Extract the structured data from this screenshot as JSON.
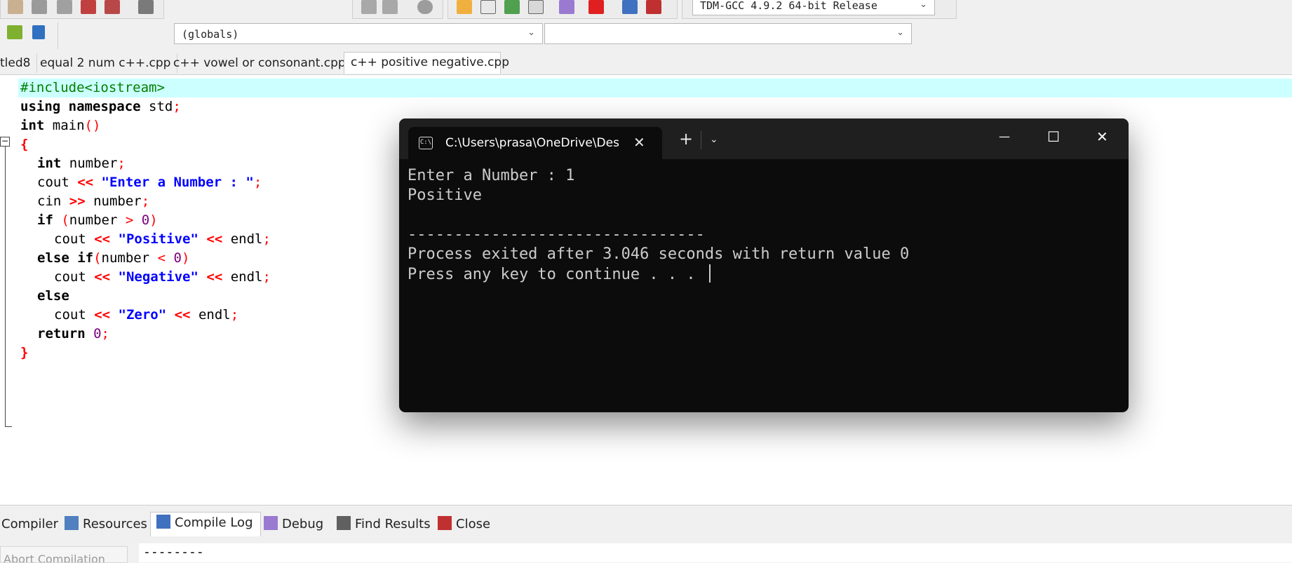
{
  "toolbar": {
    "compiler_select": "TDM-GCC 4.9.2 64-bit Release",
    "scope_select": "(globals)",
    "symbol_select": ""
  },
  "tabs": [
    {
      "label": "tled8",
      "active": false
    },
    {
      "label": "equal 2 num c++.cpp",
      "active": false
    },
    {
      "label": "c++ vowel or consonant.cpp",
      "active": false
    },
    {
      "label": "c++ positive  negative.cpp",
      "active": true
    }
  ],
  "editor": {
    "code": {
      "l1": "#include<iostream>",
      "l2_kw": "using namespace",
      "l2_rest": " std",
      "l2_semi": ";",
      "l3_kw": "int",
      "l3_fn": " main",
      "l3_parens": "()",
      "l4": "{",
      "l5_kw": "int",
      "l5_id": " number",
      "l5_semi": ";",
      "l6_id": "cout ",
      "l6_op": "<<",
      "l6_str": " \"Enter a Number : \"",
      "l6_semi": ";",
      "l7_id": "cin ",
      "l7_op": ">>",
      "l7_id2": " number",
      "l7_semi": ";",
      "l8_kw": "if",
      "l8_open": " (",
      "l8_id": "number ",
      "l8_op": ">",
      "l8_num": " 0",
      "l8_close": ")",
      "l9_id": "cout ",
      "l9_op": "<<",
      "l9_str": " \"Positive\"",
      "l9_op2": " <<",
      "l9_endl": " endl",
      "l9_semi": ";",
      "l10_kw": "else if",
      "l10_open": "(",
      "l10_id": "number ",
      "l10_op": "<",
      "l10_num": " 0",
      "l10_close": ")",
      "l11_id": "cout ",
      "l11_op": "<<",
      "l11_str": " \"Negative\"",
      "l11_op2": " <<",
      "l11_endl": " endl",
      "l11_semi": ";",
      "l12_kw": "else",
      "l13_id": "cout ",
      "l13_op": "<<",
      "l13_str": " \"Zero\"",
      "l13_op2": " <<",
      "l13_endl": " endl",
      "l13_semi": ";",
      "l14_kw": "return",
      "l14_num": " 0",
      "l14_semi": ";",
      "l15": "}"
    },
    "fold_glyph": "−"
  },
  "terminal": {
    "tab_title": "C:\\Users\\prasa\\OneDrive\\Des",
    "tab_icon_text": "C:\\",
    "lines": {
      "l1": "Enter a Number : 1",
      "l2": "Positive",
      "l3": "",
      "l4": "--------------------------------",
      "l5": "Process exited after 3.046 seconds with return value 0",
      "l6": "Press any key to continue . . . "
    },
    "close_tab_glyph": "✕",
    "new_tab_glyph": "+",
    "dropdown_glyph": "⌄",
    "minimize_glyph": "—",
    "maximize_glyph": "☐",
    "close_glyph": "✕"
  },
  "bottom_panel": {
    "tabs": [
      "Compiler",
      "Resources",
      "Compile Log",
      "Debug",
      "Find Results",
      "Close"
    ],
    "active_tab": "Compile Log",
    "abort_label": "Abort Compilation",
    "log_text": "--------"
  },
  "colors": {
    "highlight_line": "#ccffff",
    "keyword": "#000000",
    "operator": "#ff0000",
    "string": "#0000ff",
    "number": "#800080",
    "preprocessor": "#008000",
    "terminal_bg": "#0c0c0c"
  }
}
